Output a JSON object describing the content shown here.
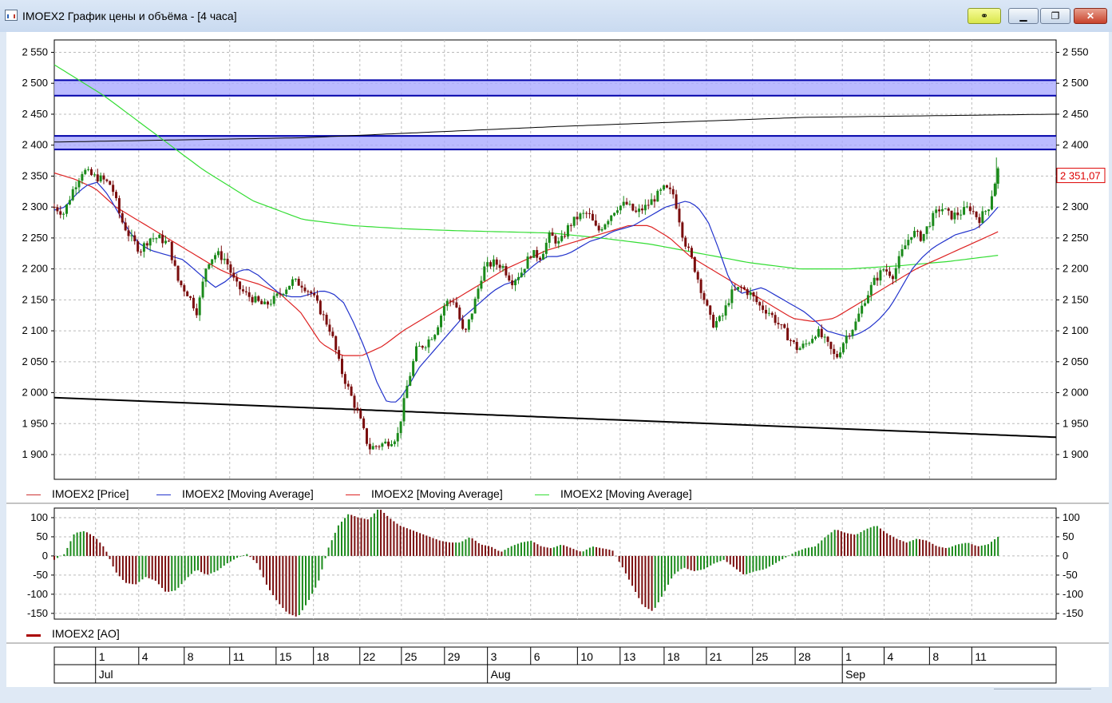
{
  "window": {
    "title": "IMOEX2 График цены и объёма - [4 часа]",
    "icon": "chart-app-icon",
    "buttons": {
      "link": "link-icon",
      "minimize": "minimize-icon",
      "maximize": "maximize-icon",
      "close": "close-icon"
    }
  },
  "colors": {
    "up": "#1a8a1a",
    "down": "#7a0d0d",
    "ma_fast": "#2233cc",
    "ma_mid": "#dd2222",
    "ma_slow": "#33dd33",
    "zone_fill": "#aaaaff",
    "zone_line": "#0000aa",
    "last_price": "#dd0000"
  },
  "legend": [
    {
      "label": "IMOEX2 [Price]",
      "color": "#cc3333"
    },
    {
      "label": "IMOEX2 [Moving Average]",
      "color": "#2233cc"
    },
    {
      "label": "IMOEX2 [Moving Average]",
      "color": "#dd2222"
    },
    {
      "label": "IMOEX2 [Moving Average]",
      "color": "#33dd33"
    }
  ],
  "ao_legend": {
    "label": "IMOEX2 [AO]",
    "color": "#aa0000"
  },
  "last_price_label": "2 351,07",
  "chart_data": [
    {
      "type": "candlestick",
      "ylim": [
        1860,
        2570
      ],
      "y_ticks": [
        "2 550",
        "2 500",
        "2 450",
        "2 400",
        "2 350",
        "2 300",
        "2 250",
        "2 200",
        "2 150",
        "2 100",
        "2 050",
        "2 000",
        "1 950",
        "1 900"
      ],
      "y_tick_values": [
        2550,
        2500,
        2450,
        2400,
        2350,
        2300,
        2250,
        2200,
        2150,
        2100,
        2050,
        2000,
        1950,
        1900
      ],
      "grid": true,
      "bars_count": 306,
      "close": [
        2300,
        2290,
        2330,
        2360,
        2350,
        2345,
        2335,
        2280,
        2250,
        2230,
        2250,
        2250,
        2240,
        2180,
        2160,
        2130,
        2210,
        2225,
        2215,
        2175,
        2160,
        2150,
        2140,
        2150,
        2165,
        2180,
        2175,
        2160,
        2130,
        2100,
        2040,
        2000,
        1960,
        1910,
        1915,
        1920,
        1930,
        2010,
        2070,
        2080,
        2100,
        2145,
        2150,
        2090,
        2140,
        2200,
        2210,
        2205,
        2180,
        2195,
        2225,
        2220,
        2255,
        2240,
        2270,
        2285,
        2290,
        2260,
        2280,
        2300,
        2305,
        2290,
        2300,
        2315,
        2330,
        2320,
        2250,
        2210,
        2160,
        2110,
        2120,
        2160,
        2170,
        2160,
        2140,
        2130,
        2110,
        2090,
        2070,
        2080,
        2100,
        2080,
        2055,
        2090,
        2110,
        2150,
        2180,
        2200,
        2190,
        2230,
        2260,
        2250,
        2280,
        2300,
        2285,
        2290,
        2300,
        2280,
        2300,
        2360
      ],
      "ma_fast": [
        2295,
        2300,
        2320,
        2335,
        2340,
        2320,
        2290,
        2260,
        2240,
        2230,
        2225,
        2220,
        2215,
        2200,
        2185,
        2170,
        2180,
        2195,
        2200,
        2190,
        2175,
        2160,
        2155,
        2155,
        2160,
        2165,
        2160,
        2145,
        2110,
        2070,
        2020,
        1985,
        1985,
        2010,
        2040,
        2060,
        2080,
        2100,
        2120,
        2135,
        2150,
        2165,
        2175,
        2180,
        2195,
        2210,
        2220,
        2220,
        2225,
        2235,
        2245,
        2250,
        2260,
        2265,
        2270,
        2280,
        2290,
        2300,
        2305,
        2310,
        2300,
        2275,
        2230,
        2180,
        2160,
        2165,
        2170,
        2160,
        2150,
        2140,
        2130,
        2115,
        2100,
        2095,
        2090,
        2095,
        2105,
        2120,
        2140,
        2170,
        2200,
        2220,
        2235,
        2245,
        2255,
        2260,
        2265,
        2280,
        2300
      ],
      "ma_mid": [
        2355,
        2345,
        2330,
        2300,
        2280,
        2260,
        2240,
        2220,
        2200,
        2185,
        2175,
        2160,
        2130,
        2080,
        2060,
        2060,
        2075,
        2100,
        2120,
        2140,
        2160,
        2180,
        2200,
        2215,
        2230,
        2240,
        2250,
        2260,
        2270,
        2270,
        2250,
        2220,
        2200,
        2180,
        2160,
        2140,
        2120,
        2115,
        2120,
        2140,
        2160,
        2180,
        2200,
        2215,
        2230,
        2245,
        2260
      ],
      "ma_slow": [
        2530,
        2480,
        2420,
        2360,
        2310,
        2280,
        2270,
        2265,
        2262,
        2260,
        2258,
        2250,
        2240,
        2225,
        2210,
        2200,
        2200,
        2205,
        2212,
        2222
      ],
      "trend_upper": [
        2405,
        2412,
        2430,
        2445,
        2450
      ],
      "trend_lower": [
        1992,
        1960,
        1928
      ],
      "zones": [
        [
          2480,
          2505
        ],
        [
          2393,
          2415
        ]
      ],
      "spike_high": 2380
    },
    {
      "type": "bar",
      "name": "AO",
      "ylim": [
        -165,
        125
      ],
      "y_ticks": [
        "100",
        "50",
        "0",
        "-50",
        "-100",
        "-150"
      ],
      "y_tick_values": [
        100,
        50,
        0,
        -50,
        -100,
        -150
      ],
      "profile": [
        -10,
        5,
        60,
        65,
        50,
        20,
        -40,
        -70,
        -75,
        -55,
        -65,
        -95,
        -90,
        -60,
        -35,
        -50,
        -40,
        -20,
        -5,
        5,
        -20,
        -80,
        -120,
        -150,
        -160,
        -120,
        -70,
        20,
        80,
        110,
        100,
        95,
        125,
        100,
        80,
        70,
        60,
        50,
        40,
        35,
        35,
        50,
        30,
        25,
        10,
        25,
        35,
        40,
        25,
        20,
        30,
        20,
        10,
        25,
        20,
        15,
        -30,
        -80,
        -130,
        -145,
        -100,
        -50,
        -30,
        -40,
        -35,
        -20,
        -10,
        -30,
        -50,
        -40,
        -35,
        -20,
        -5,
        10,
        20,
        25,
        50,
        70,
        60,
        55,
        70,
        80,
        60,
        45,
        35,
        45,
        40,
        25,
        20,
        30,
        35,
        25,
        30,
        50
      ]
    }
  ],
  "x_axis": {
    "days": [
      {
        "label": "1",
        "pos": 0.0412
      },
      {
        "label": "4",
        "pos": 0.0843
      },
      {
        "label": "8",
        "pos": 0.1297
      },
      {
        "label": "11",
        "pos": 0.1751
      },
      {
        "label": "15",
        "pos": 0.2214
      },
      {
        "label": "18",
        "pos": 0.2587
      },
      {
        "label": "22",
        "pos": 0.305
      },
      {
        "label": "25",
        "pos": 0.3465
      },
      {
        "label": "29",
        "pos": 0.3895
      },
      {
        "label": "3",
        "pos": 0.4324
      },
      {
        "label": "6",
        "pos": 0.4755
      },
      {
        "label": "10",
        "pos": 0.5222
      },
      {
        "label": "13",
        "pos": 0.5648
      },
      {
        "label": "18",
        "pos": 0.6087
      },
      {
        "label": "21",
        "pos": 0.6509
      },
      {
        "label": "25",
        "pos": 0.697
      },
      {
        "label": "28",
        "pos": 0.7395
      },
      {
        "label": "1",
        "pos": 0.7866
      },
      {
        "label": "4",
        "pos": 0.8283
      },
      {
        "label": "8",
        "pos": 0.8736
      },
      {
        "label": "11",
        "pos": 0.9158
      }
    ],
    "months": [
      {
        "label": "Jul",
        "pos": 0.0412
      },
      {
        "label": "Aug",
        "pos": 0.4324
      },
      {
        "label": "Sep",
        "pos": 0.7866
      }
    ]
  }
}
